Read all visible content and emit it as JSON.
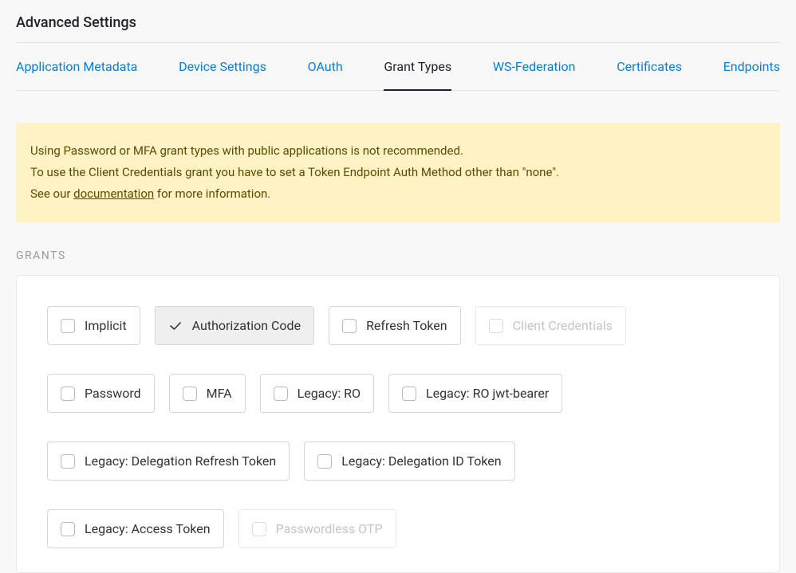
{
  "page_title": "Advanced Settings",
  "tabs": [
    {
      "label": "Application Metadata",
      "active": false
    },
    {
      "label": "Device Settings",
      "active": false
    },
    {
      "label": "OAuth",
      "active": false
    },
    {
      "label": "Grant Types",
      "active": true
    },
    {
      "label": "WS-Federation",
      "active": false
    },
    {
      "label": "Certificates",
      "active": false
    },
    {
      "label": "Endpoints",
      "active": false
    }
  ],
  "warning": {
    "line1": "Using Password or MFA grant types with public applications is not recommended.",
    "line2_pre": "To use the Client Credentials grant you have to set a Token Endpoint Auth Method other than \"none\".",
    "line3_pre": "See our ",
    "line3_link": "documentation",
    "line3_post": " for more information."
  },
  "section_label": "GRANTS",
  "grants": {
    "row1": [
      {
        "key": "implicit",
        "label": "Implicit",
        "checked": false,
        "disabled": false
      },
      {
        "key": "authorization-code",
        "label": "Authorization Code",
        "checked": true,
        "disabled": false
      },
      {
        "key": "refresh-token",
        "label": "Refresh Token",
        "checked": false,
        "disabled": false
      },
      {
        "key": "client-credentials",
        "label": "Client Credentials",
        "checked": false,
        "disabled": true
      }
    ],
    "row2": [
      {
        "key": "password",
        "label": "Password",
        "checked": false,
        "disabled": false
      },
      {
        "key": "mfa",
        "label": "MFA",
        "checked": false,
        "disabled": false
      },
      {
        "key": "legacy-ro",
        "label": "Legacy: RO",
        "checked": false,
        "disabled": false
      },
      {
        "key": "legacy-ro-jwt",
        "label": "Legacy: RO jwt-bearer",
        "checked": false,
        "disabled": false
      }
    ],
    "row3": [
      {
        "key": "legacy-delegation-refresh-token",
        "label": "Legacy: Delegation Refresh Token",
        "checked": false,
        "disabled": false
      },
      {
        "key": "legacy-delegation-id-token",
        "label": "Legacy: Delegation ID Token",
        "checked": false,
        "disabled": false
      }
    ],
    "row4": [
      {
        "key": "legacy-access-token",
        "label": "Legacy: Access Token",
        "checked": false,
        "disabled": false
      },
      {
        "key": "passwordless-otp",
        "label": "Passwordless OTP",
        "checked": false,
        "disabled": true
      }
    ]
  }
}
